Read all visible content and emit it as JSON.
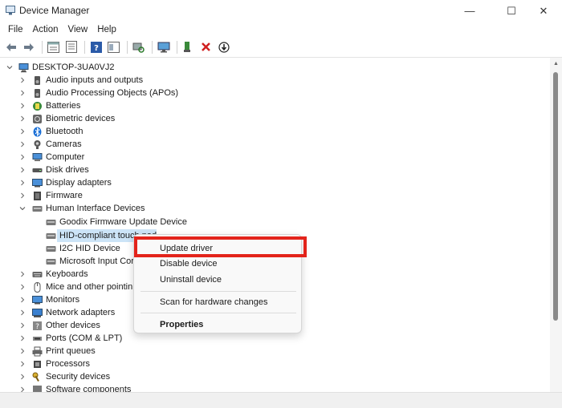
{
  "window": {
    "title": "Device Manager",
    "minimize_glyph": "—",
    "maximize_glyph": "☐",
    "close_glyph": "✕"
  },
  "menu": [
    "File",
    "Action",
    "View",
    "Help"
  ],
  "toolbar": {
    "buttons": [
      "back-icon",
      "forward-icon",
      "properties-pane-icon",
      "device-list-icon",
      "help-icon",
      "view-icon",
      "scan-hardware-icon",
      "monitor-icon",
      "enable-device-icon",
      "uninstall-icon",
      "update-download-icon"
    ]
  },
  "tree": {
    "root": "DESKTOP-3UA0VJ2",
    "items": [
      {
        "label": "Audio inputs and outputs",
        "icon": "speaker-icon"
      },
      {
        "label": "Audio Processing Objects (APOs)",
        "icon": "speaker-icon"
      },
      {
        "label": "Batteries",
        "icon": "battery-icon"
      },
      {
        "label": "Biometric devices",
        "icon": "fingerprint-icon"
      },
      {
        "label": "Bluetooth",
        "icon": "bluetooth-icon"
      },
      {
        "label": "Cameras",
        "icon": "camera-icon"
      },
      {
        "label": "Computer",
        "icon": "computer-icon"
      },
      {
        "label": "Disk drives",
        "icon": "disk-icon"
      },
      {
        "label": "Display adapters",
        "icon": "display-icon"
      },
      {
        "label": "Firmware",
        "icon": "chip-icon"
      },
      {
        "label": "Human Interface Devices",
        "icon": "hid-icon"
      },
      {
        "label": "Goodix Firmware Update Device",
        "icon": "hid-icon"
      },
      {
        "label": "HID-compliant touch pad",
        "icon": "hid-icon"
      },
      {
        "label": "I2C HID Device",
        "icon": "hid-icon"
      },
      {
        "label": "Microsoft Input Cor",
        "icon": "hid-icon"
      },
      {
        "label": "Keyboards",
        "icon": "keyboard-icon"
      },
      {
        "label": "Mice and other pointin",
        "icon": "mouse-icon"
      },
      {
        "label": "Monitors",
        "icon": "monitor-icon"
      },
      {
        "label": "Network adapters",
        "icon": "network-icon"
      },
      {
        "label": "Other devices",
        "icon": "unknown-device-icon"
      },
      {
        "label": "Ports (COM & LPT)",
        "icon": "port-icon"
      },
      {
        "label": "Print queues",
        "icon": "printer-icon"
      },
      {
        "label": "Processors",
        "icon": "cpu-icon"
      },
      {
        "label": "Security devices",
        "icon": "key-icon"
      },
      {
        "label": "Software components",
        "icon": "component-icon"
      }
    ]
  },
  "context_menu": {
    "update_driver": "Update driver",
    "disable_device": "Disable device",
    "uninstall_device": "Uninstall device",
    "scan_hardware": "Scan for hardware changes",
    "properties": "Properties",
    "highlight_color": "#e3241b"
  }
}
